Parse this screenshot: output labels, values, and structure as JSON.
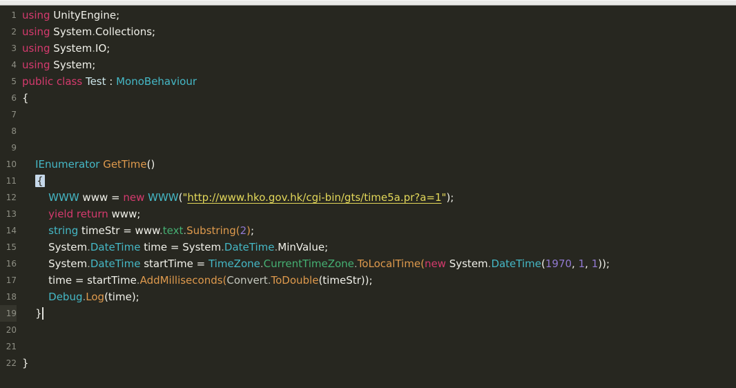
{
  "window": {
    "top_strip_note": "light toolbar edge above editor"
  },
  "colors": {
    "background": "#272720",
    "top_strip": "#e9e9e7",
    "gutter_text": "#8f9085",
    "default_text": "#f1f1ea",
    "keyword_pink": "#d63a6e",
    "type_cyan": "#45b8c6",
    "class_definition": "#cfe8ec",
    "method_orange": "#df9a4d",
    "property_green": "#45b073",
    "number_purple": "#9179d1",
    "string_yellow": "#e3d85a",
    "punct_gray": "#a5a69c",
    "static_class_gray": "#c6c9bf",
    "bracket_match_bg": "#c6d8e9",
    "current_line_gutter_bg": "#35352d",
    "cursor": "#e2e2dd"
  },
  "editor": {
    "language": "csharp",
    "current_line": 19,
    "bracket_match_line": 11,
    "lines": [
      {
        "n": 1,
        "tokens": [
          {
            "t": "using",
            "c": "kw"
          },
          {
            "t": " UnityEngine;",
            "c": "pln"
          }
        ]
      },
      {
        "n": 2,
        "tokens": [
          {
            "t": "using",
            "c": "kw"
          },
          {
            "t": " System",
            "c": "pln"
          },
          {
            "t": ".",
            "c": "pun"
          },
          {
            "t": "Collections;",
            "c": "pln"
          }
        ]
      },
      {
        "n": 3,
        "tokens": [
          {
            "t": "using",
            "c": "kw"
          },
          {
            "t": " System",
            "c": "pln"
          },
          {
            "t": ".",
            "c": "pun"
          },
          {
            "t": "IO;",
            "c": "pln"
          }
        ]
      },
      {
        "n": 4,
        "tokens": [
          {
            "t": "using",
            "c": "kw"
          },
          {
            "t": " System;",
            "c": "pln"
          }
        ]
      },
      {
        "n": 5,
        "tokens": [
          {
            "t": "public",
            "c": "kw"
          },
          {
            "t": " ",
            "c": "pln"
          },
          {
            "t": "class",
            "c": "kw"
          },
          {
            "t": " ",
            "c": "pln"
          },
          {
            "t": "Test",
            "c": "defty"
          },
          {
            "t": " : ",
            "c": "pln"
          },
          {
            "t": "MonoBehaviour",
            "c": "ty"
          }
        ]
      },
      {
        "n": 6,
        "tokens": [
          {
            "t": "{",
            "c": "pln"
          }
        ]
      },
      {
        "n": 7,
        "tokens": []
      },
      {
        "n": 8,
        "tokens": []
      },
      {
        "n": 9,
        "tokens": []
      },
      {
        "n": 10,
        "tokens": [
          {
            "t": "    ",
            "c": "pln"
          },
          {
            "t": "IEnumerator",
            "c": "ty"
          },
          {
            "t": " ",
            "c": "pln"
          },
          {
            "t": "GetTime",
            "c": "meth"
          },
          {
            "t": "()",
            "c": "pln"
          }
        ]
      },
      {
        "n": 11,
        "tokens": [
          {
            "t": "    ",
            "c": "pln"
          },
          {
            "t": "{",
            "c": "brk"
          }
        ]
      },
      {
        "n": 12,
        "tokens": [
          {
            "t": "        ",
            "c": "pln"
          },
          {
            "t": "WWW",
            "c": "ty"
          },
          {
            "t": " www = ",
            "c": "pln"
          },
          {
            "t": "new",
            "c": "kw"
          },
          {
            "t": " ",
            "c": "pln"
          },
          {
            "t": "WWW",
            "c": "ty"
          },
          {
            "t": "(",
            "c": "pln"
          },
          {
            "t": "\"",
            "c": "str"
          },
          {
            "t": "http://www.hko.gov.hk/cgi-bin/gts/time5a.pr?a=1",
            "c": "url"
          },
          {
            "t": "\"",
            "c": "str"
          },
          {
            "t": ");",
            "c": "pln"
          }
        ]
      },
      {
        "n": 13,
        "tokens": [
          {
            "t": "        ",
            "c": "pln"
          },
          {
            "t": "yield return",
            "c": "kw"
          },
          {
            "t": " www;",
            "c": "pln"
          }
        ]
      },
      {
        "n": 14,
        "tokens": [
          {
            "t": "        ",
            "c": "pln"
          },
          {
            "t": "string",
            "c": "ty"
          },
          {
            "t": " timeStr = www",
            "c": "pln"
          },
          {
            "t": ".",
            "c": "pun"
          },
          {
            "t": "text",
            "c": "prop"
          },
          {
            "t": ".",
            "c": "pun"
          },
          {
            "t": "Substring",
            "c": "meth"
          },
          {
            "t": "(",
            "c": "meth"
          },
          {
            "t": "2",
            "c": "num"
          },
          {
            "t": ")",
            "c": "meth"
          },
          {
            "t": ";",
            "c": "pln"
          }
        ]
      },
      {
        "n": 15,
        "tokens": [
          {
            "t": "        ",
            "c": "pln"
          },
          {
            "t": "System",
            "c": "pln"
          },
          {
            "t": ".",
            "c": "pun"
          },
          {
            "t": "DateTime",
            "c": "ty"
          },
          {
            "t": " time = System",
            "c": "pln"
          },
          {
            "t": ".",
            "c": "pun"
          },
          {
            "t": "DateTime",
            "c": "ty"
          },
          {
            "t": ".",
            "c": "pun"
          },
          {
            "t": "MinValue;",
            "c": "pln"
          }
        ]
      },
      {
        "n": 16,
        "tokens": [
          {
            "t": "        ",
            "c": "pln"
          },
          {
            "t": "System",
            "c": "pln"
          },
          {
            "t": ".",
            "c": "pun"
          },
          {
            "t": "DateTime",
            "c": "ty"
          },
          {
            "t": " startTime = ",
            "c": "pln"
          },
          {
            "t": "TimeZone",
            "c": "ty"
          },
          {
            "t": ".",
            "c": "pun"
          },
          {
            "t": "CurrentTimeZone",
            "c": "prop"
          },
          {
            "t": ".",
            "c": "pun"
          },
          {
            "t": "ToLocalTime",
            "c": "meth"
          },
          {
            "t": "(",
            "c": "meth"
          },
          {
            "t": "new",
            "c": "kw"
          },
          {
            "t": " System",
            "c": "pln"
          },
          {
            "t": ".",
            "c": "pun"
          },
          {
            "t": "DateTime",
            "c": "ty"
          },
          {
            "t": "(",
            "c": "pln"
          },
          {
            "t": "1970",
            "c": "num"
          },
          {
            "t": ", ",
            "c": "pln"
          },
          {
            "t": "1",
            "c": "num"
          },
          {
            "t": ", ",
            "c": "pln"
          },
          {
            "t": "1",
            "c": "num"
          },
          {
            "t": "));",
            "c": "pln"
          }
        ]
      },
      {
        "n": 17,
        "tokens": [
          {
            "t": "        ",
            "c": "pln"
          },
          {
            "t": "time = startTime",
            "c": "pln"
          },
          {
            "t": ".",
            "c": "pun"
          },
          {
            "t": "AddMilliseconds",
            "c": "meth"
          },
          {
            "t": "(",
            "c": "meth"
          },
          {
            "t": "Convert",
            "c": "stat"
          },
          {
            "t": ".",
            "c": "pun"
          },
          {
            "t": "ToDouble",
            "c": "meth"
          },
          {
            "t": "(timeStr));",
            "c": "pln"
          }
        ]
      },
      {
        "n": 18,
        "tokens": [
          {
            "t": "        ",
            "c": "pln"
          },
          {
            "t": "Debug",
            "c": "ty"
          },
          {
            "t": ".",
            "c": "pun"
          },
          {
            "t": "Log",
            "c": "meth"
          },
          {
            "t": "(time);",
            "c": "pln"
          }
        ]
      },
      {
        "n": 19,
        "current": true,
        "cursor": true,
        "tokens": [
          {
            "t": "    ",
            "c": "pln"
          },
          {
            "t": "}",
            "c": "pln"
          }
        ]
      },
      {
        "n": 20,
        "tokens": []
      },
      {
        "n": 21,
        "tokens": []
      },
      {
        "n": 22,
        "tokens": [
          {
            "t": "}",
            "c": "pln"
          }
        ]
      }
    ]
  }
}
